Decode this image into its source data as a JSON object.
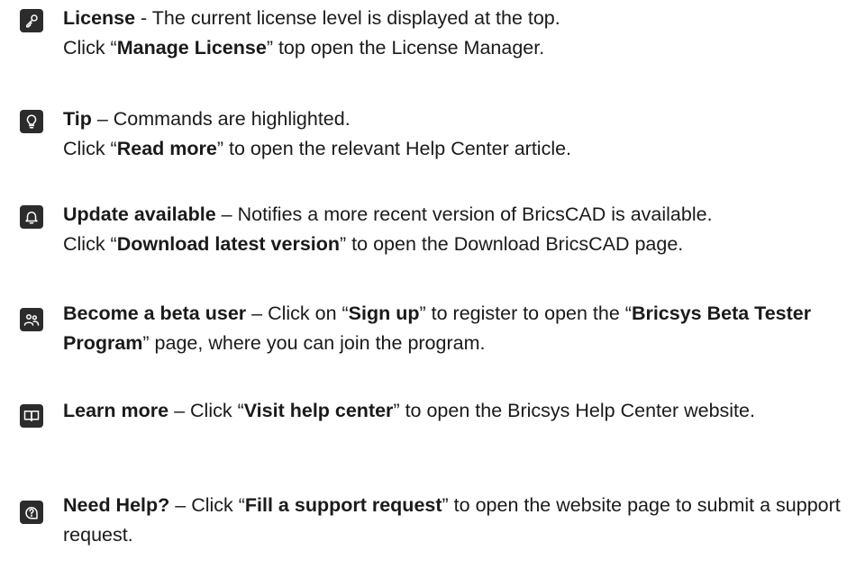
{
  "items": [
    {
      "icon": "key-icon",
      "title": "License",
      "sep": " - ",
      "t1": "The current license level is displayed at the top.",
      "t2": "Click “",
      "b1": "Manage License",
      "t3": "” top open the License Manager."
    },
    {
      "icon": "lightbulb-icon",
      "title": "Tip",
      "sep": " – ",
      "t1": "Commands are highlighted.",
      "t2": "Click “",
      "b1": "Read more",
      "t3": "” to open the relevant Help Center article."
    },
    {
      "icon": "bell-icon",
      "title": "Update available",
      "sep": " – ",
      "t1": "Notifies a more recent version of BricsCAD is available.",
      "t2": "Click “",
      "b1": "Download latest version",
      "t3": "” to open the Download BricsCAD page."
    },
    {
      "icon": "users-icon",
      "title": "Become a beta user",
      "sep": " – ",
      "t1": "Click on “",
      "b1": "Sign up",
      "t2": "” to register to open the “",
      "b2": "Bricsys Beta Tester Program",
      "t3": "” page, where you can join the program."
    },
    {
      "icon": "book-icon",
      "title": "Learn more",
      "sep": " – ",
      "t1": "Click “",
      "b1": "Visit help center",
      "t2": "” to open the Bricsys Help Center website."
    },
    {
      "icon": "help-chat-icon",
      "title": "Need Help?",
      "sep": " – ",
      "t1": "Click “",
      "b1": "Fill a support request",
      "t2": "” to open the website page to submit a support request."
    }
  ]
}
